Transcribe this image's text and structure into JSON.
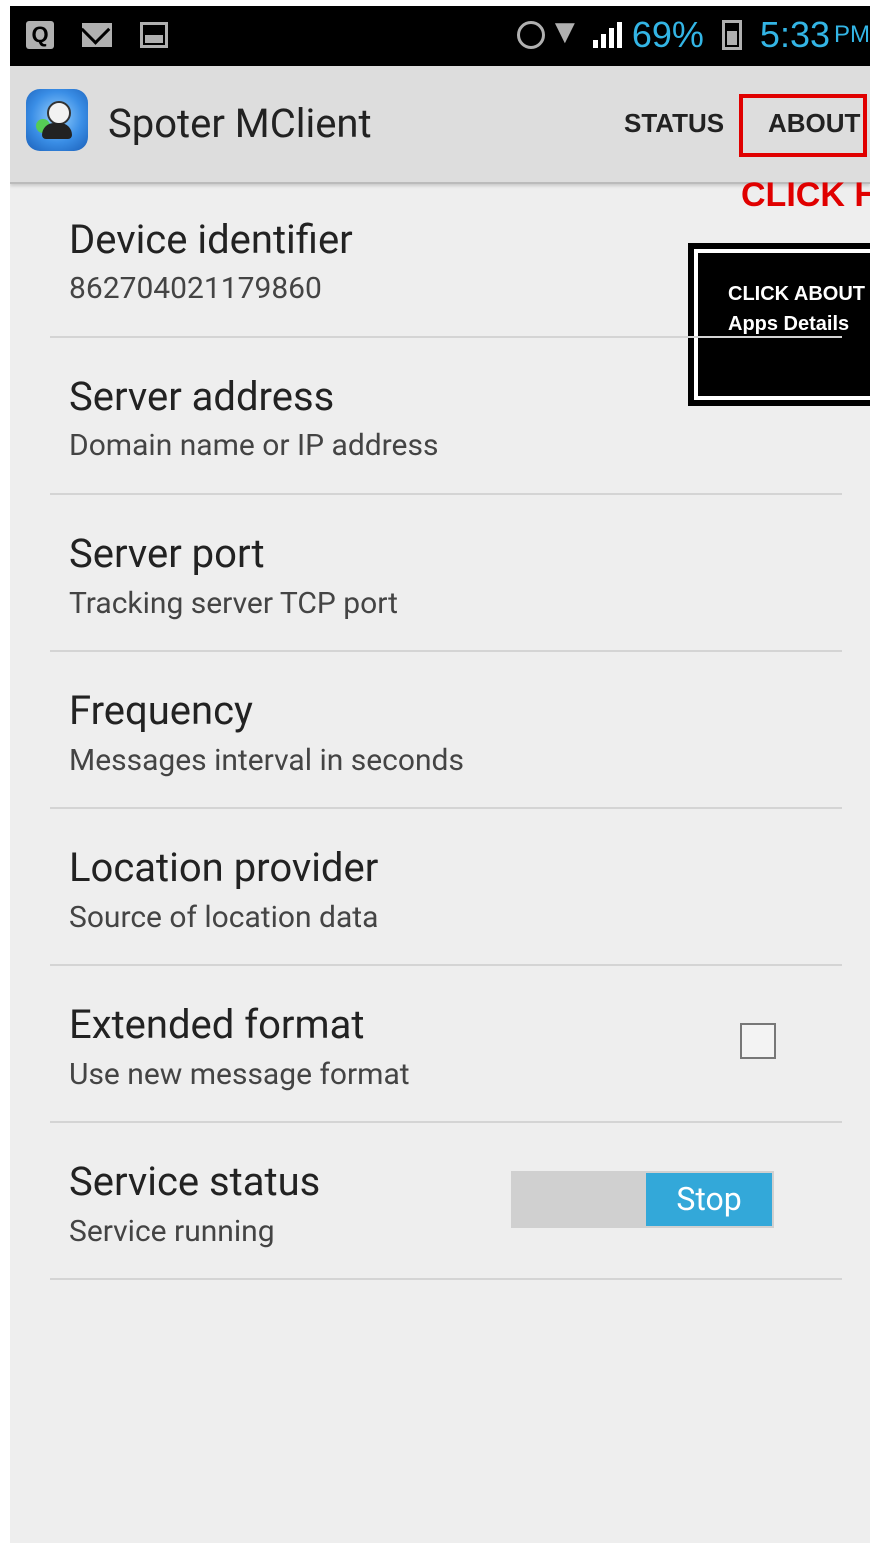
{
  "statusbar": {
    "battery_pct": "69%",
    "time": "5:33",
    "ampm": "PM",
    "q_label": "Q"
  },
  "appbar": {
    "title": "Spoter MClient",
    "tabs": [
      "STATUS",
      "ABOUT"
    ]
  },
  "annotation": {
    "click_here": "CLICK HERE",
    "callout_lines": [
      "CLICK  ABOUT",
      "Apps Details"
    ]
  },
  "prefs": [
    {
      "title": "Device identifier",
      "summary": "862704021179860"
    },
    {
      "title": "Server address",
      "summary": "Domain name or IP address"
    },
    {
      "title": "Server port",
      "summary": "Tracking server TCP port"
    },
    {
      "title": "Frequency",
      "summary": "Messages interval in seconds"
    },
    {
      "title": "Location provider",
      "summary": "Source of location data"
    },
    {
      "title": "Extended format",
      "summary": "Use new message format"
    },
    {
      "title": "Service status",
      "summary": "Service running"
    }
  ],
  "service_toggle_label": "Stop",
  "colors": {
    "accent": "#33a8d9",
    "annotation_red": "#e00000"
  }
}
